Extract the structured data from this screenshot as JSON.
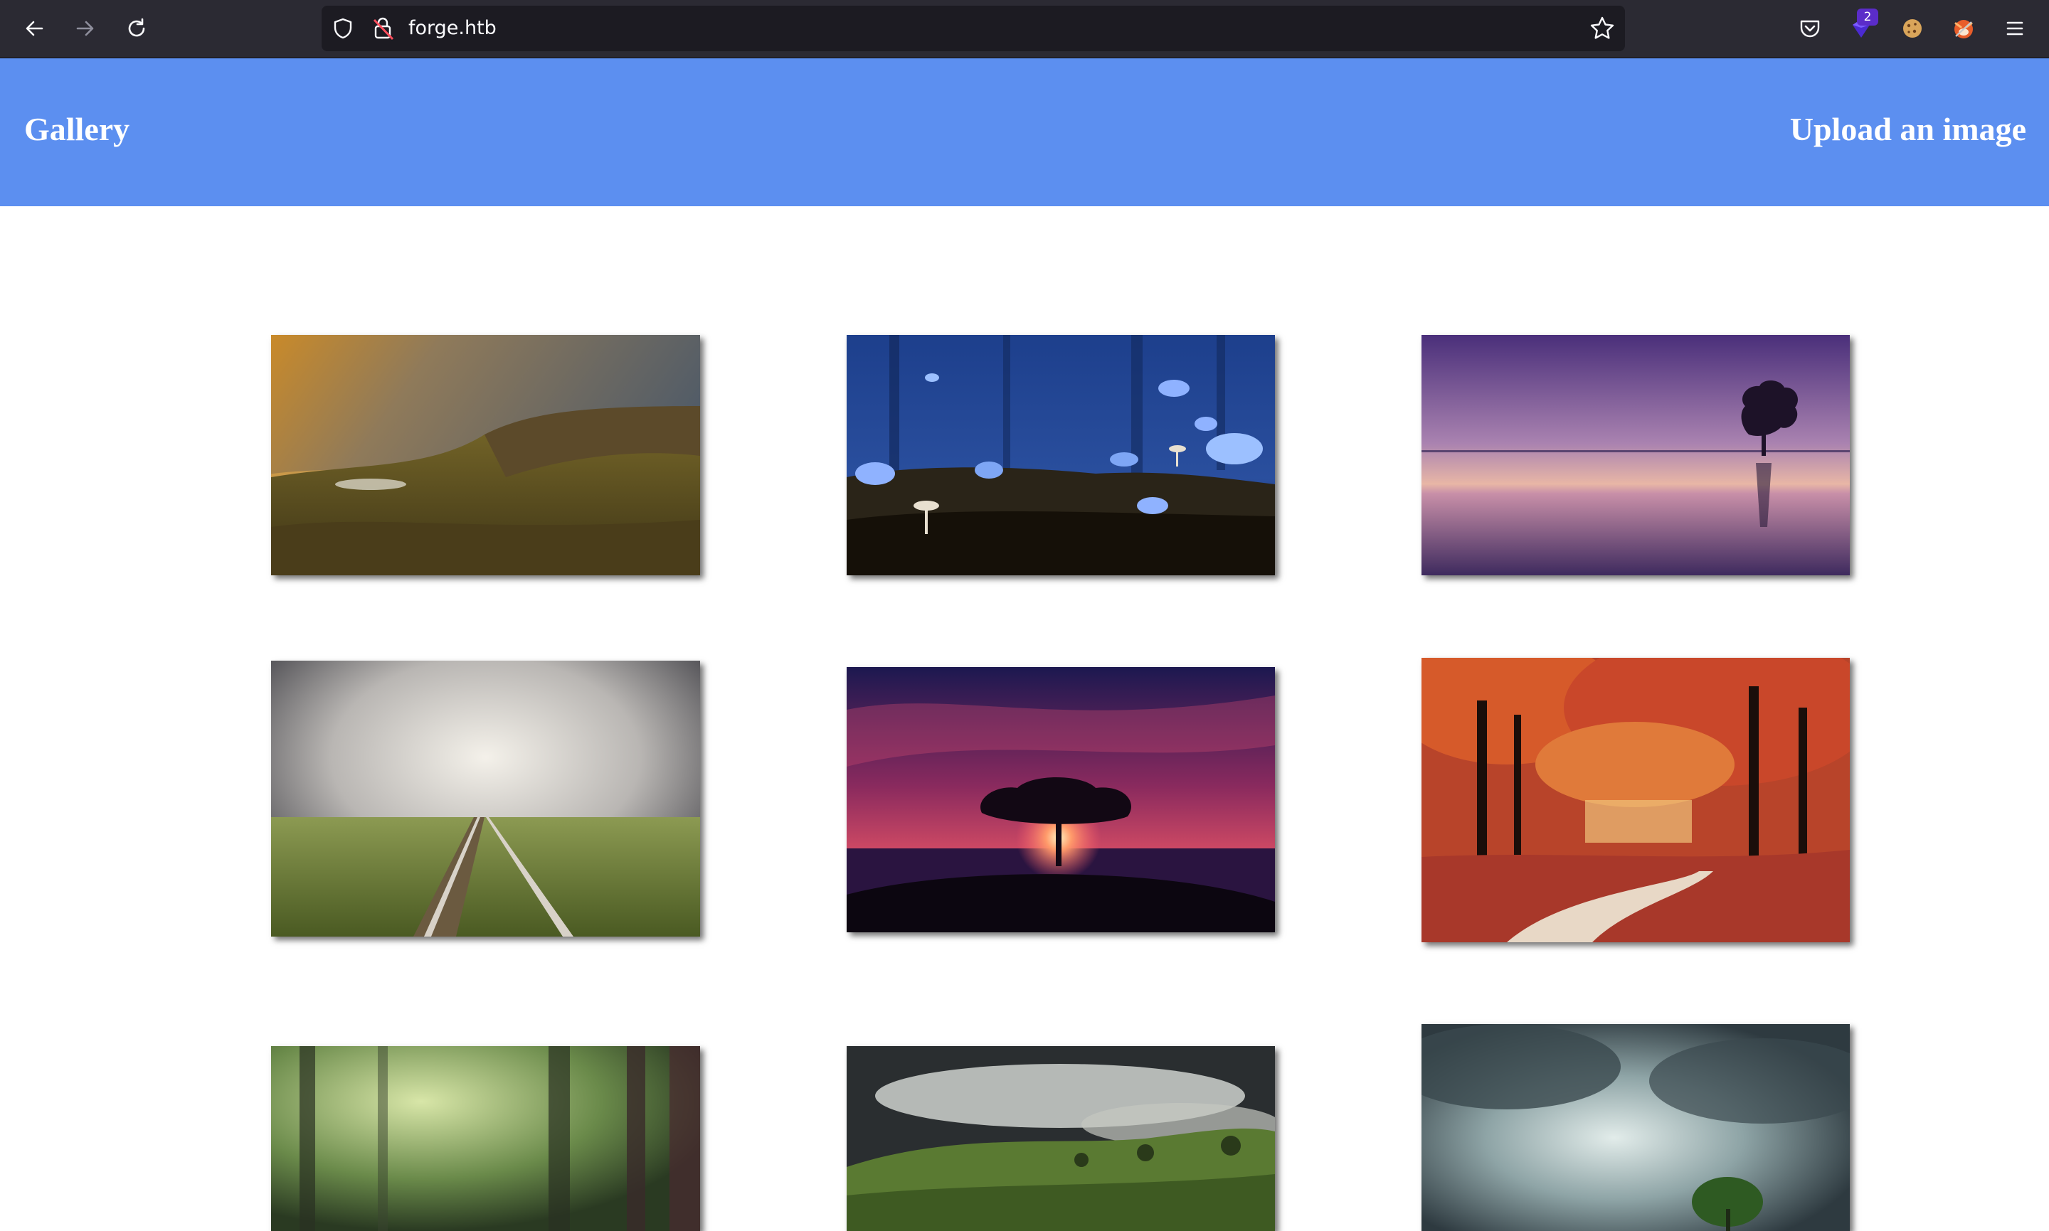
{
  "browser": {
    "url": "forge.htb",
    "extension_badge": "2",
    "icons": {
      "back": "back-arrow-icon",
      "forward": "forward-arrow-icon",
      "reload": "reload-icon",
      "shield": "shield-icon",
      "lock": "insecure-lock-icon",
      "bookmark": "bookmark-star-icon",
      "pocket": "pocket-icon",
      "extension": "extension-icon",
      "cookie": "cookie-icon",
      "fox": "fox-extension-icon",
      "menu": "hamburger-menu-icon"
    }
  },
  "header": {
    "title": "Gallery",
    "upload_link": "Upload an image",
    "background": "#5c8ff0"
  },
  "gallery": {
    "images": [
      "mountain-valley-sunset",
      "blue-butterflies-mushrooms",
      "lake-tree-purple-dusk",
      "railway-tracks-stormy-sky",
      "tree-silhouette-red-sky",
      "autumn-forest-path",
      "misty-green-forest",
      "foggy-green-hills",
      "stormy-sky-tree"
    ]
  }
}
